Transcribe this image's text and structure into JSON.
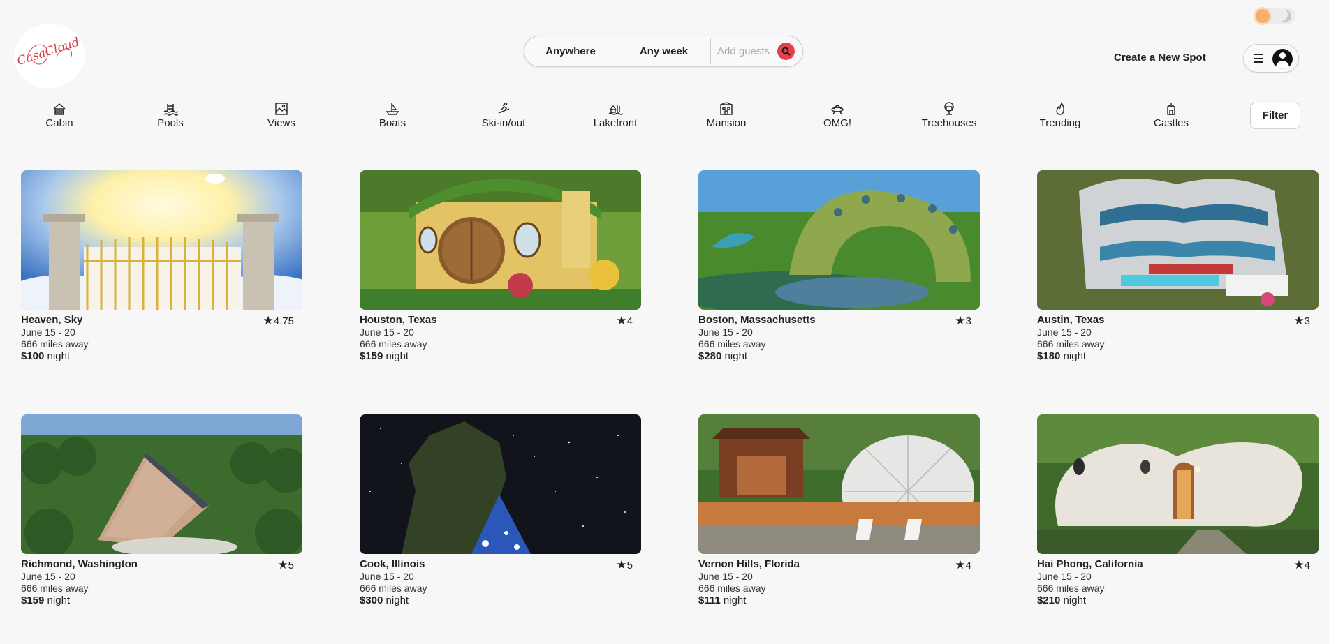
{
  "app": {
    "logo_text": "CasaCloud"
  },
  "search": {
    "anywhere": "Anywhere",
    "any_week": "Any week",
    "guests_placeholder": "Add guests"
  },
  "header": {
    "create_spot": "Create a New Spot"
  },
  "categories": [
    {
      "label": "Cabin",
      "icon": "cabin-icon"
    },
    {
      "label": "Pools",
      "icon": "pool-icon"
    },
    {
      "label": "Views",
      "icon": "views-icon"
    },
    {
      "label": "Boats",
      "icon": "boat-icon"
    },
    {
      "label": "Ski-in/out",
      "icon": "ski-icon"
    },
    {
      "label": "Lakefront",
      "icon": "lakefront-icon"
    },
    {
      "label": "Mansion",
      "icon": "mansion-icon"
    },
    {
      "label": "OMG!",
      "icon": "ufo-icon"
    },
    {
      "label": "Treehouses",
      "icon": "treehouse-icon"
    },
    {
      "label": "Trending",
      "icon": "flame-icon"
    },
    {
      "label": "Castles",
      "icon": "castle-icon"
    }
  ],
  "filter": {
    "label": "Filter"
  },
  "price_suffix": "night",
  "listings": [
    {
      "location": "Heaven, Sky",
      "rating": "4.75",
      "dates": "June 15 - 20",
      "distance": "666 miles away",
      "price": "$100"
    },
    {
      "location": "Houston, Texas",
      "rating": "4",
      "dates": "June 15 - 20",
      "distance": "666 miles away",
      "price": "$159"
    },
    {
      "location": "Boston, Massachusetts",
      "rating": "3",
      "dates": "June 15 - 20",
      "distance": "666 miles away",
      "price": "$280"
    },
    {
      "location": "Austin, Texas",
      "rating": "3",
      "dates": "June 15 - 20",
      "distance": "666 miles away",
      "price": "$180"
    },
    {
      "location": "Richmond, Washington",
      "rating": "5",
      "dates": "June 15 - 20",
      "distance": "666 miles away",
      "price": "$159"
    },
    {
      "location": "Cook, Illinois",
      "rating": "5",
      "dates": "June 15 - 20",
      "distance": "666 miles away",
      "price": "$300"
    },
    {
      "location": "Vernon Hills, Florida",
      "rating": "4",
      "dates": "June 15 - 20",
      "distance": "666 miles away",
      "price": "$111"
    },
    {
      "location": "Hai Phong, California",
      "rating": "4",
      "dates": "June 15 - 20",
      "distance": "666 miles away",
      "price": "$210"
    }
  ]
}
